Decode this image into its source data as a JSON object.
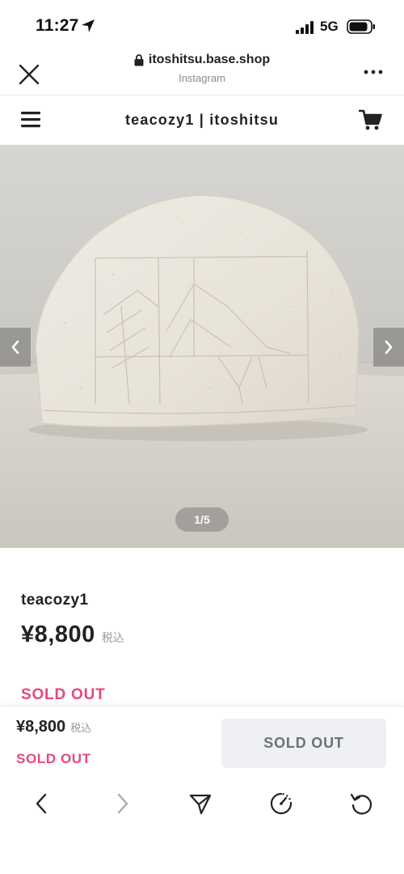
{
  "status_bar": {
    "time": "11:27",
    "network": "5G"
  },
  "browser": {
    "url": "itoshitsu.base.shop",
    "source": "Instagram"
  },
  "shop": {
    "title": "teacozy1 | itoshitsu"
  },
  "carousel": {
    "counter": "1/5",
    "current": 1,
    "total": 5
  },
  "product": {
    "name": "teacozy1",
    "price": "¥8,800",
    "tax_label": "税込",
    "status": "SOLD OUT"
  },
  "purchase_bar": {
    "price": "¥8,800",
    "tax_label": "税込",
    "status": "SOLD OUT",
    "button_label": "SOLD OUT"
  },
  "colors": {
    "sold_out_accent": "#e5497a",
    "disabled_button_bg": "#eef0f3",
    "disabled_button_text": "#6d7179"
  },
  "icons": {
    "status_bar": [
      "location-arrow-icon",
      "cellular-signal-icon",
      "battery-icon"
    ],
    "browser_bar": [
      "close-icon",
      "lock-icon",
      "more-icon"
    ],
    "shop_header": [
      "menu-icon",
      "cart-icon"
    ],
    "carousel": [
      "chevron-left-icon",
      "chevron-right-icon"
    ],
    "toolbar": [
      "back-icon",
      "forward-icon",
      "share-icon",
      "speed-dial-icon",
      "reload-icon"
    ]
  }
}
